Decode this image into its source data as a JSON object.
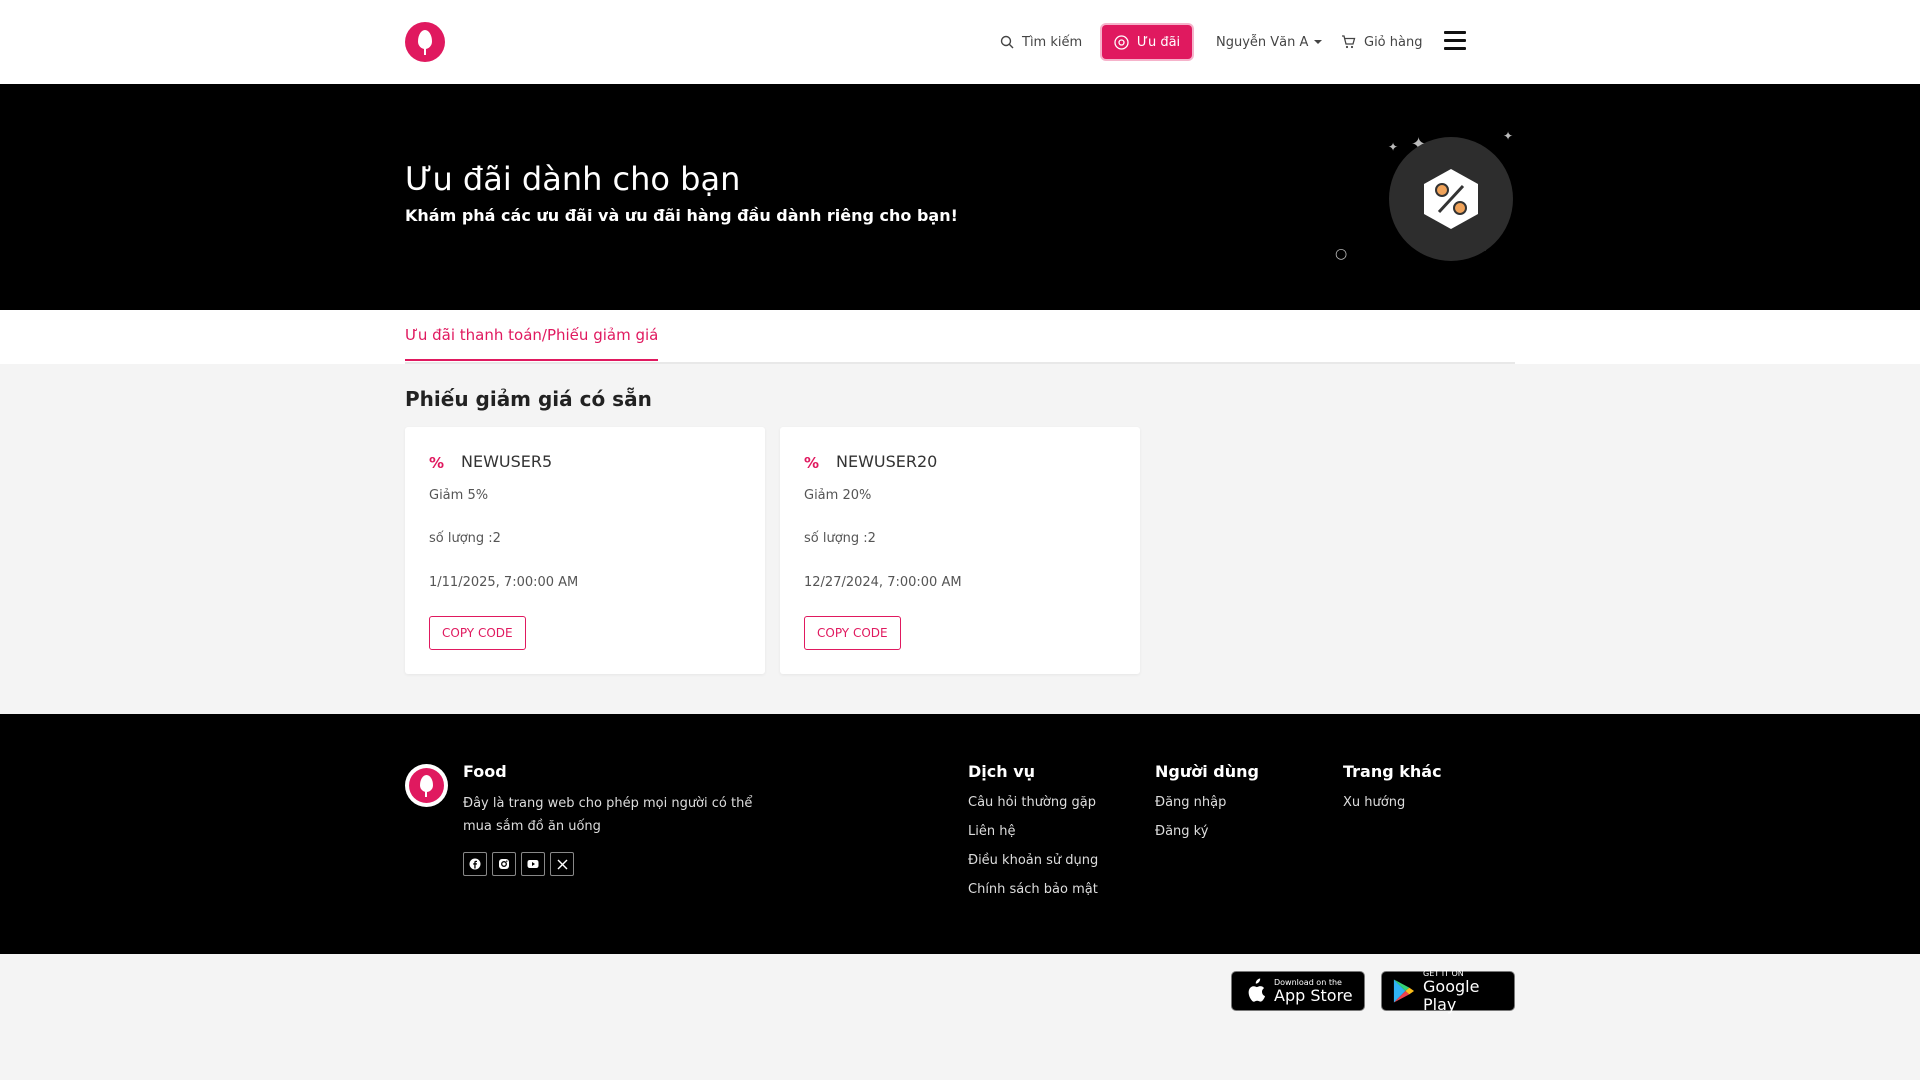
{
  "header": {
    "search_label": "Tìm kiếm",
    "deals_label": "Ưu đãi",
    "user_name": "Nguyễn Văn A",
    "cart_label": "Giỏ hàng",
    "accent_color": "#e0195f"
  },
  "hero": {
    "title": "Ưu đãi dành cho bạn",
    "subtitle": "Khám phá các ưu đãi và ưu đãi hàng đầu dành riêng cho bạn!"
  },
  "tabs": [
    {
      "label": "Ưu đãi thanh toán/Phiếu giảm giá",
      "active": true
    }
  ],
  "vouchers": {
    "section_title": "Phiếu giảm giá có sẵn",
    "items": [
      {
        "code": "NEWUSER5",
        "discount": "Giảm 5%",
        "quantity": "số lượng :2",
        "expiry": "1/11/2025, 7:00:00 AM",
        "button": "COPY CODE"
      },
      {
        "code": "NEWUSER20",
        "discount": "Giảm 20%",
        "quantity": "số lượng :2",
        "expiry": "12/27/2024, 7:00:00 AM",
        "button": "COPY CODE"
      }
    ]
  },
  "footer": {
    "brand": "Food",
    "description": "Đây là trang web cho phép mọi người có thể mua sắm đồ ăn uống",
    "social_icons": [
      "facebook-icon",
      "instagram-icon",
      "youtube-icon",
      "x-icon"
    ],
    "columns": [
      {
        "heading": "Dịch vụ",
        "links": [
          "Câu hỏi thường gặp",
          "Liên hệ",
          "Điều khoản sử dụng",
          "Chính sách bảo mật"
        ]
      },
      {
        "heading": "Người dùng",
        "links": [
          "Đăng nhập",
          "Đăng ký"
        ]
      },
      {
        "heading": "Trang khác",
        "links": [
          "Xu hướng"
        ]
      }
    ]
  },
  "stores": {
    "appstore_small": "Download on the",
    "appstore_big": "App Store",
    "gplay_small": "GET IT ON",
    "gplay_big": "Google Play"
  }
}
